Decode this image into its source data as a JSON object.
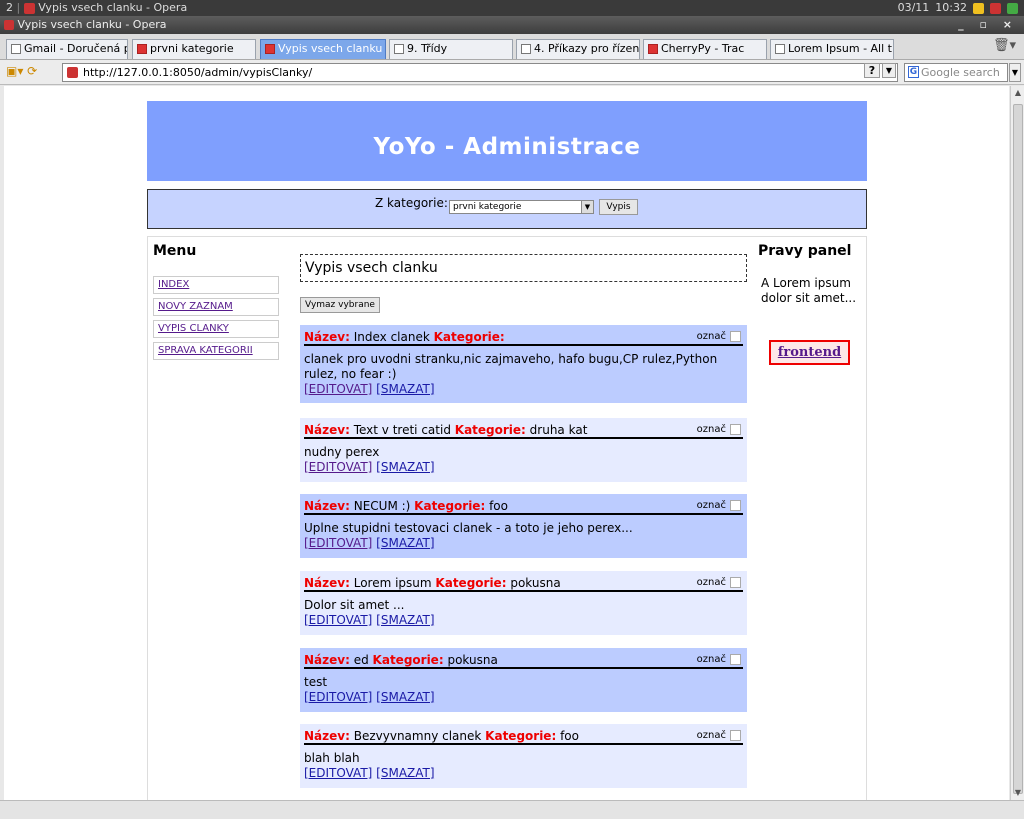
{
  "os": {
    "workspace": "2",
    "window_label": "Vypis vsech clanku - Opera",
    "date": "03/11",
    "time": "10:32"
  },
  "window": {
    "title": "Vypis vsech clanku - Opera"
  },
  "tabs": [
    {
      "label": "Gmail - Doručená p..."
    },
    {
      "label": "prvni kategorie"
    },
    {
      "label": "Vypis vsech clanku"
    },
    {
      "label": "9. Třídy"
    },
    {
      "label": "4. Příkazy pro řízení..."
    },
    {
      "label": "CherryPy - Trac"
    },
    {
      "label": "Lorem Ipsum - All t..."
    }
  ],
  "address": {
    "url": "http://127.0.0.1:8050/admin/vypisClanky/"
  },
  "search": {
    "placeholder": "Google search"
  },
  "page": {
    "header_title": "YoYo - Administrace",
    "filter": {
      "label": "Z kategorie:",
      "selected": "prvni kategorie",
      "button": "Vypis"
    },
    "menu": {
      "title": "Menu",
      "items": [
        "INDEX",
        "NOVY ZAZNAM",
        "VYPIS CLANKY",
        "SPRAVA KATEGORII"
      ]
    },
    "list_title": "Vypis vsech clanku",
    "delete_button": "Vymaz vybrane",
    "labels": {
      "name": "Název:",
      "category": "Kategorie:",
      "mark": "označ",
      "edit": "[EDITOVAT]",
      "delete": "[SMAZAT]"
    },
    "articles": [
      {
        "name": "Index clanek",
        "category": "",
        "perex": "clanek pro uvodni stranku,nic zajmaveho, hafo bugu,CP rulez,Python rulez, no fear :)"
      },
      {
        "name": "Text v treti catid",
        "category": "druha kat",
        "perex": "nudny perex"
      },
      {
        "name": "NECUM :)",
        "category": "foo",
        "perex": "Uplne stupidni testovaci clanek - a toto je jeho perex..."
      },
      {
        "name": "Lorem ipsum",
        "category": "pokusna",
        "perex": "Dolor sit amet ..."
      },
      {
        "name": "ed",
        "category": "pokusna",
        "perex": "test"
      },
      {
        "name": "Bezvyvnamny clanek",
        "category": "foo",
        "perex": "blah blah"
      }
    ],
    "right_panel": {
      "title": "Pravy panel",
      "text": "A Lorem ipsum dolor sit amet...",
      "button": "frontend"
    }
  }
}
